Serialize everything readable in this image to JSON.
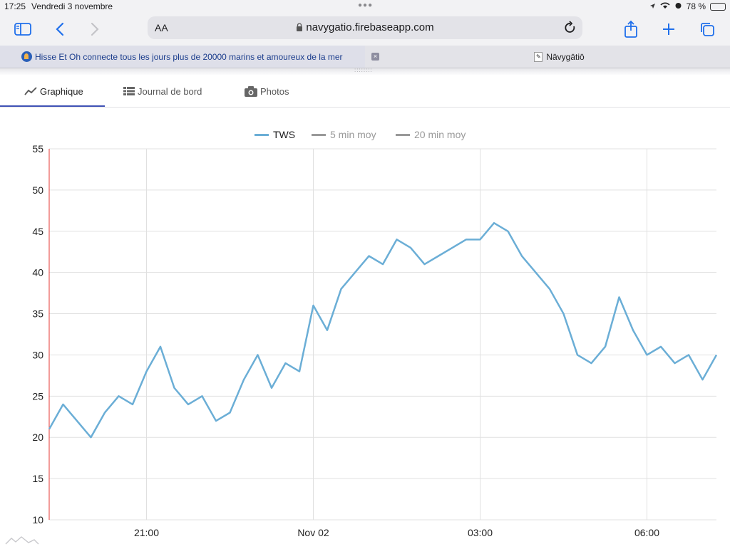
{
  "status_bar": {
    "time": "17:25",
    "date": "Vendredi 3 novembre",
    "battery": "78 %",
    "battery_level": 0.78
  },
  "browser": {
    "aa_label": "AA",
    "url": "navygatio.firebaseapp.com",
    "tabs": [
      {
        "label": "Hisse Et Oh connecte tous les jours plus de 20000 marins et amoureux de la mer",
        "close": "×"
      },
      {
        "label": "Nāvygātiō"
      }
    ]
  },
  "app_nav": {
    "tabs": [
      {
        "label": "Graphique"
      },
      {
        "label": "Journal de bord"
      },
      {
        "label": "Photos"
      }
    ]
  },
  "colors": {
    "tws": "#6baed6",
    "legend_grey": "#999999",
    "accent": "#3f51b5",
    "grid": "#e0e0e0"
  },
  "chart_data": {
    "type": "line",
    "legend": [
      "TWS",
      "5 min moy",
      "20 min moy"
    ],
    "y_ticks": [
      "55",
      "50",
      "45",
      "40",
      "35",
      "30",
      "25",
      "20",
      "15",
      "10"
    ],
    "x_ticks": [
      "21:00",
      "Nov 02",
      "03:00",
      "06:00"
    ],
    "ylim": [
      10,
      55
    ],
    "x_start": "2023-11-01T19:15",
    "x_end": "2023-11-02T07:15",
    "series": [
      {
        "name": "TWS",
        "x": [
          "2023-11-01T19:15",
          "2023-11-01T19:30",
          "2023-11-01T19:45",
          "2023-11-01T20:00",
          "2023-11-01T20:15",
          "2023-11-01T20:30",
          "2023-11-01T20:45",
          "2023-11-01T21:00",
          "2023-11-01T21:15",
          "2023-11-01T21:30",
          "2023-11-01T21:45",
          "2023-11-01T22:00",
          "2023-11-01T22:15",
          "2023-11-01T22:30",
          "2023-11-01T22:45",
          "2023-11-01T23:00",
          "2023-11-01T23:15",
          "2023-11-01T23:30",
          "2023-11-01T23:45",
          "2023-11-02T00:00",
          "2023-11-02T00:15",
          "2023-11-02T00:30",
          "2023-11-02T00:45",
          "2023-11-02T01:00",
          "2023-11-02T01:15",
          "2023-11-02T01:30",
          "2023-11-02T01:45",
          "2023-11-02T02:00",
          "2023-11-02T02:15",
          "2023-11-02T02:30",
          "2023-11-02T02:45",
          "2023-11-02T03:00",
          "2023-11-02T03:15",
          "2023-11-02T03:30",
          "2023-11-02T03:45",
          "2023-11-02T04:00",
          "2023-11-02T04:15",
          "2023-11-02T04:30",
          "2023-11-02T04:45",
          "2023-11-02T05:00",
          "2023-11-02T05:15",
          "2023-11-02T05:30",
          "2023-11-02T05:45",
          "2023-11-02T06:00",
          "2023-11-02T06:15",
          "2023-11-02T06:30",
          "2023-11-02T06:45",
          "2023-11-02T07:00",
          "2023-11-02T07:15"
        ],
        "values": [
          21,
          24,
          22,
          20,
          23,
          25,
          24,
          28,
          31,
          26,
          24,
          25,
          22,
          23,
          27,
          30,
          26,
          29,
          28,
          36,
          33,
          38,
          40,
          42,
          41,
          44,
          43,
          41,
          42,
          43,
          44,
          44,
          46,
          45,
          42,
          40,
          38,
          35,
          30,
          29,
          31,
          37,
          33,
          30,
          31,
          29,
          30,
          27,
          30
        ]
      }
    ]
  }
}
